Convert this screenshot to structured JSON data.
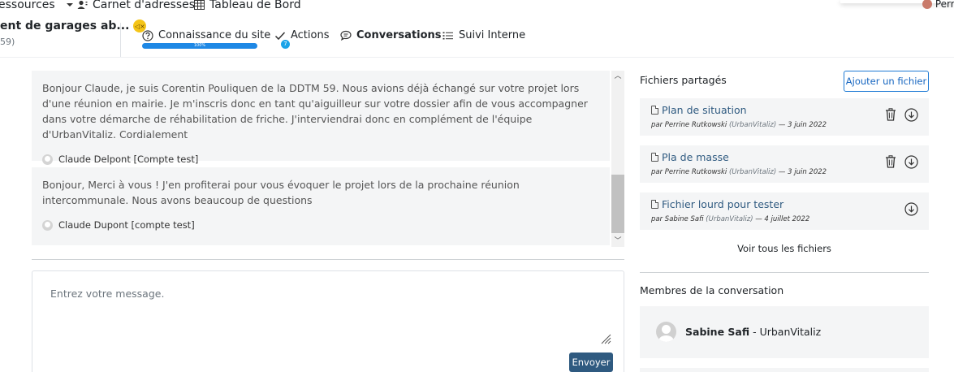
{
  "topnav": {
    "ressources": "essources",
    "carnet": "Carnet d'adresses",
    "tableau": "Tableau de Bord",
    "user": "Perri"
  },
  "project": {
    "title": "ent de garages ab...",
    "subtitle": "59)",
    "badge_icon": "speaker-muted-icon"
  },
  "tabs": [
    {
      "label": "Connaissance du site",
      "icon": "question-circle-icon",
      "progress_percent": 100,
      "progress_label": "100%"
    },
    {
      "label": "Actions",
      "icon": "check-icon",
      "badge": "7"
    },
    {
      "label": "Conversations",
      "icon": "chat-icon",
      "active": true
    },
    {
      "label": "Suivi Interne",
      "icon": "list-icon"
    }
  ],
  "messages": [
    {
      "text": "Bonjour Claude, je suis Corentin Pouliquen de la DDTM 59. Nous avions déjà échangé sur votre projet lors d'une réunion en mairie. Je m'inscris donc en tant qu'aiguilleur sur votre dossier afin de vous accompagner dans votre démarche de réhabilitation de friche. J'interviendrai donc en complément de l'équipe d'UrbanVitaliz. Cordialement",
      "author": "Claude Delpont [Compte test]"
    },
    {
      "text": "Bonjour, Merci à vous ! J'en profiterai pour vous évoquer le projet lors de la prochaine réunion intercommunale. Nous avons beaucoup de questions",
      "author": "Claude Dupont [compte test]"
    }
  ],
  "compose": {
    "placeholder": "Entrez votre message.",
    "send_label": "Envoyer"
  },
  "files": {
    "title": "Fichiers partagés",
    "add_label": "Ajouter un fichier",
    "items": [
      {
        "name": "Plan de situation",
        "by": "par Perrine Rutkowski",
        "org": "(UrbanVitaliz)",
        "date": "— 3 juin 2022",
        "deletable": true
      },
      {
        "name": "Pla de masse",
        "by": "par Perrine Rutkowski",
        "org": "(UrbanVitaliz)",
        "date": "— 3 juin 2022",
        "deletable": true
      },
      {
        "name": "Fichier lourd pour tester",
        "by": "par Sabine Safi",
        "org": "(UrbanVitaliz)",
        "date": "— 4 juillet 2022",
        "deletable": false
      }
    ],
    "see_all": "Voir tous les fichiers"
  },
  "members": {
    "title": "Membres de la conversation",
    "items": [
      {
        "name": "Sabine Safi",
        "org": " - UrbanVitaliz"
      }
    ]
  },
  "colors": {
    "primary": "#2f5a80",
    "progress": "#1e88e5",
    "badge": "#1aa3e8",
    "card_bg": "#f4f5f6"
  }
}
